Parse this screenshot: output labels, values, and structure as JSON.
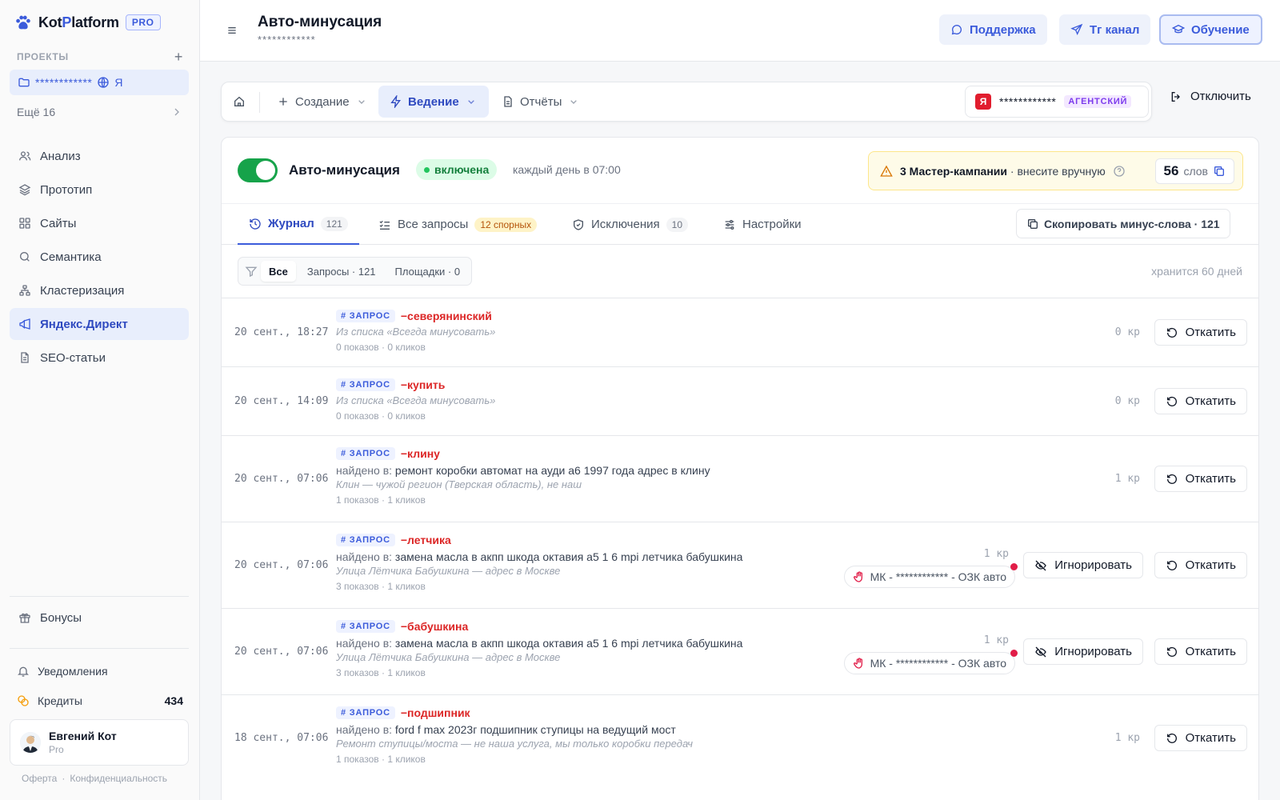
{
  "brand": {
    "name_a": "Kot",
    "name_b": "P",
    "name_c": "latform",
    "badge": "PRO"
  },
  "sidebar": {
    "projects_label": "ПРОЕКТЫ",
    "add": "+",
    "project": {
      "name": "************",
      "suffix": "Я"
    },
    "more": "Ещё 16",
    "items": [
      {
        "label": "Анализ",
        "icon": "users-icon"
      },
      {
        "label": "Прототип",
        "icon": "layers-icon"
      },
      {
        "label": "Сайты",
        "icon": "grid-icon"
      },
      {
        "label": "Семантика",
        "icon": "search-icon"
      },
      {
        "label": "Кластеризация",
        "icon": "cluster-icon"
      },
      {
        "label": "Яндекс.Директ",
        "icon": "megaphone-icon",
        "active": true
      },
      {
        "label": "SEO-статьи",
        "icon": "document-icon"
      }
    ],
    "bonuses": "Бонусы",
    "notifications": "Уведомления",
    "credits_label": "Кредиты",
    "credits_value": "434",
    "user": {
      "name": "Евгений Кот",
      "plan": "Pro"
    },
    "legal": {
      "offer": "Оферта",
      "sep": "·",
      "privacy": "Конфиденциальность"
    }
  },
  "header": {
    "title": "Авто-минусация",
    "subtitle": "************",
    "support": "Поддержка",
    "tg": "Тг канал",
    "edu": "Обучение"
  },
  "toolbar": {
    "create": "Создание",
    "manage": "Ведение",
    "reports": "Отчёты",
    "account": "************",
    "account_badge": "АГЕНТСКИЙ",
    "ya": "Я",
    "disconnect": "Отключить"
  },
  "card": {
    "title": "Авто-минусация",
    "status": "включена",
    "schedule": "каждый день в 07:00",
    "warning_bold": "3 Мастер-кампании",
    "warning_rest": " · внесите вручную",
    "words_count": "56",
    "words_label": "слов"
  },
  "tabs": [
    {
      "label": "Журнал",
      "count": "121"
    },
    {
      "label": "Все запросы",
      "count": "12 спорных"
    },
    {
      "label": "Исключения",
      "count": "10"
    },
    {
      "label": "Настройки"
    }
  ],
  "copy_button": "Скопировать минус-слова · 121",
  "filters": {
    "all": "Все",
    "queries": "Запросы · 121",
    "sites": "Площадки · 0"
  },
  "stored": "хранится 60 дней",
  "labels": {
    "tag": "ЗАПРОС",
    "found_in": "найдено в: ",
    "rollback": "Откатить",
    "ignore": "Игнорировать"
  },
  "rows": [
    {
      "date": "20 сент., 18:27",
      "word": "−северянинский",
      "found": "",
      "reason": "Из списка «Всегда минусовать»",
      "stats": "0 показов · 0 кликов",
      "kp": "0 кр",
      "mk": ""
    },
    {
      "date": "20 сент., 14:09",
      "word": "−купить",
      "found": "",
      "reason": "Из списка «Всегда минусовать»",
      "stats": "0 показов · 0 кликов",
      "kp": "0 кр",
      "mk": ""
    },
    {
      "date": "20 сент., 07:06",
      "word": "−клину",
      "found": "ремонт коробки автомат на ауди а6 1997 года адрес в клину",
      "reason": "Клин — чужой регион (Тверская область), не наш",
      "stats": "1 показов · 1 кликов",
      "kp": "1 кр",
      "mk": ""
    },
    {
      "date": "20 сент., 07:06",
      "word": "−летчика",
      "found": "замена масла в акпп шкода октавия а5 1 6 mpi летчика бабушкина",
      "reason": "Улица Лётчика Бабушкина — адрес в Москве",
      "stats": "3 показов · 1 кликов",
      "kp": "1 кр",
      "mk": "МК - ************ - ОЗК авто"
    },
    {
      "date": "20 сент., 07:06",
      "word": "−бабушкина",
      "found": "замена масла в акпп шкода октавия а5 1 6 mpi летчика бабушкина",
      "reason": "Улица Лётчика Бабушкина — адрес в Москве",
      "stats": "3 показов · 1 кликов",
      "kp": "1 кр",
      "mk": "МК - ************ - ОЗК авто"
    },
    {
      "date": "18 сент., 07:06",
      "word": "−подшипник",
      "found": "ford f max 2023г подшипник ступицы на ведущий мост",
      "reason": "Ремонт ступицы/моста — не наша услуга, мы только коробки передач",
      "stats": "1 показов · 1 кликов",
      "kp": "1 кр",
      "mk": ""
    }
  ]
}
